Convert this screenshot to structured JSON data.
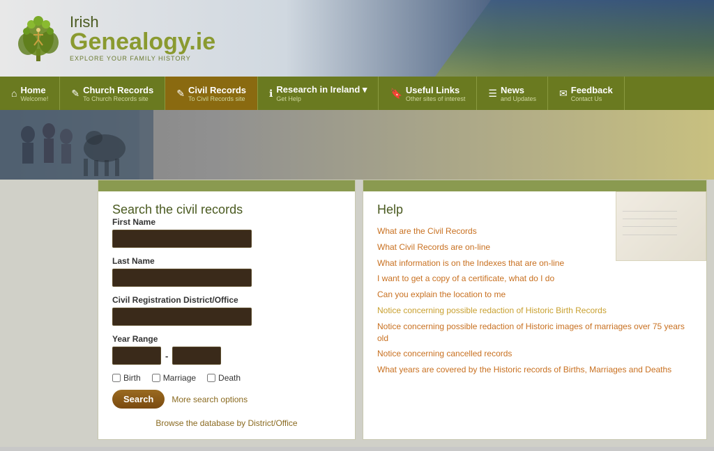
{
  "site": {
    "title": "Irish Genealogy.ie",
    "irish": "Irish",
    "genealogy": "Genealogy",
    "tld": ".ie",
    "tagline": "EXPLORE YOUR FAMILY HISTORY"
  },
  "nav": {
    "items": [
      {
        "id": "home",
        "icon": "⌂",
        "title": "Home",
        "sub": "Welcome!"
      },
      {
        "id": "church-records",
        "icon": "✎",
        "title": "Church Records",
        "sub": "To Church Records site"
      },
      {
        "id": "civil-records",
        "icon": "✎",
        "title": "Civil Records",
        "sub": "To Civil Records site",
        "active": true
      },
      {
        "id": "research",
        "icon": "ℹ",
        "title": "Research in Ireland",
        "sub": "Get Help",
        "dropdown": true
      },
      {
        "id": "useful-links",
        "icon": "☰",
        "title": "Useful Links",
        "sub": "Other sites of interest"
      },
      {
        "id": "news",
        "icon": "☰",
        "title": "News",
        "sub": "and Updates"
      },
      {
        "id": "feedback",
        "icon": "✉",
        "title": "Feedback",
        "sub": "Contact Us"
      }
    ]
  },
  "search": {
    "title": "Search the civil records",
    "first_name_label": "First Name",
    "last_name_label": "Last Name",
    "district_label": "Civil Registration District/Office",
    "year_range_label": "Year Range",
    "birth_label": "Birth",
    "marriage_label": "Marriage",
    "death_label": "Death",
    "search_button": "Search",
    "more_options": "More search options",
    "browse_link": "Browse the database by District/Office"
  },
  "help": {
    "title": "Help",
    "links": [
      "What are the Civil Records",
      "What Civil Records are on-line",
      "What information is on the Indexes that are on-line",
      "I want to get a copy of a certificate, what do I do",
      "Can you explain the location to me",
      "Notice concerning possible redaction of Historic Birth Records",
      "Notice concerning possible redaction of Historic images of marriages over 75 years old",
      "Notice concerning cancelled records",
      "What years are covered by the Historic records of Births, Marriages and Deaths"
    ]
  }
}
